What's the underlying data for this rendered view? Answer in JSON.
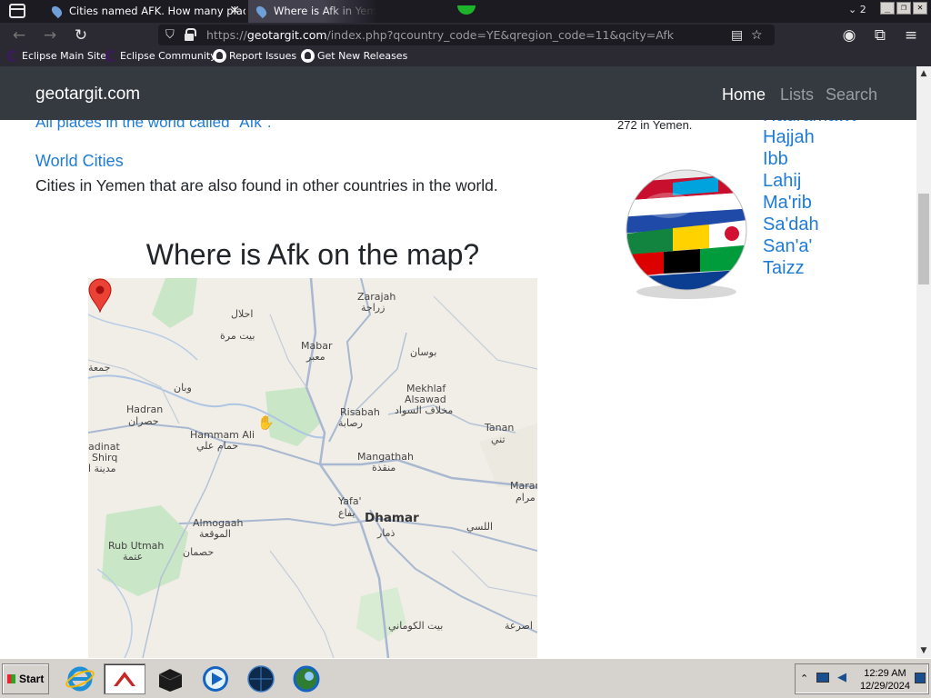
{
  "browser": {
    "tabs": [
      {
        "title": "Cities named AFK. How many place",
        "active": false
      },
      {
        "title": "Where is Afk in Yemen",
        "active": true
      }
    ],
    "tab_count": "2",
    "url_prefix": "https://",
    "url_host": "geotargit.com",
    "url_rest": "/index.php?qcountry_code=YE&qregion_code=11&qcity=Afk",
    "bookmarks": [
      "Eclipse Main Site",
      "Eclipse Community",
      "Report Issues",
      "Get New Releases"
    ]
  },
  "site": {
    "brand": "geotargit.com",
    "menu": [
      "Home",
      "Lists",
      "Search"
    ]
  },
  "main": {
    "all_places_link": "All places in the world called \"Afk\".",
    "world_cities_link": "World Cities",
    "world_cities_desc": "Cities in Yemen that are also found in other countries in the world.",
    "map_title": "Where is Afk on the map?"
  },
  "map": {
    "labels": [
      "Zarajah",
      "زراجة",
      "احلال",
      "بيت مرة",
      "Mabar",
      "معبر",
      "بوسان",
      "جمعة",
      "وبان",
      "Hadran",
      "حصران",
      "Mekhlaf",
      "Alsawad",
      "مخلاف السواد",
      "Risabah",
      "رصابة",
      "Tanan",
      "تني",
      "adinat",
      "Shirq",
      "مدينة ا",
      "Hammam Ali",
      "حمام علي",
      "Mangathah",
      "منقذة",
      "Marar",
      "مرام",
      "Yafa'",
      "يفاع",
      "Dhamar",
      "ذمار",
      "Almogaah",
      "الموقعة",
      "اللسي",
      "Rub Utmah",
      "عتمة",
      "حصمان",
      "بيت الكوماني",
      "اصرعة"
    ]
  },
  "sidebar": {
    "count_text": "272 in Yemen.",
    "regions": [
      "Hadramawt",
      "Hajjah",
      "Ibb",
      "Lahij",
      "Ma'rib",
      "Sa'dah",
      "San'a'",
      "Taizz"
    ]
  },
  "taskbar": {
    "start_label": "Start",
    "time": "12:29 AM",
    "date": "12/29/2024"
  }
}
